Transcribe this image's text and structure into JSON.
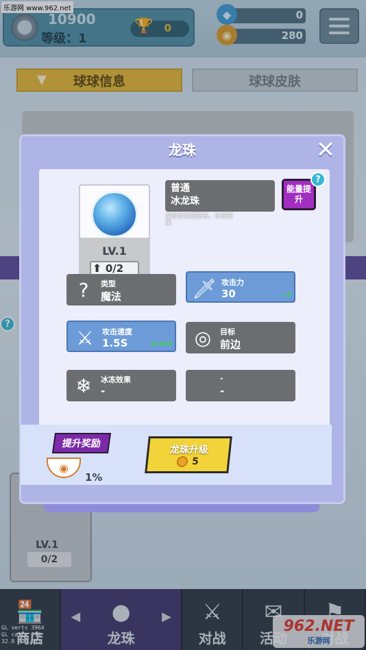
{
  "watermark_top": "乐游网 www.962.net",
  "player": {
    "score": "10900",
    "level_label": "等级：1",
    "trophies": "0"
  },
  "resources": {
    "gems": "0",
    "coins": "280"
  },
  "tabs": {
    "info": "球球信息",
    "skin": "球球皮肤"
  },
  "bg_card": {
    "level": "LV.1",
    "progress": "0/2"
  },
  "modal": {
    "title": "龙珠",
    "ball_level": "LV.1",
    "ball_progress": "0/2",
    "name_line1": "普通",
    "name_line2": "冰龙珠",
    "description": "使目标减速受冻，冰冻效果",
    "energy_button": "能量提升",
    "help": "?",
    "stats": [
      {
        "label": "类型",
        "value": "魔法",
        "bonus": "",
        "icon": "question-icon",
        "style": "gray"
      },
      {
        "label": "攻击力",
        "value": "30",
        "bonus": "+3",
        "icon": "sword-icon",
        "style": "blue"
      },
      {
        "label": "攻击速度",
        "value": "1.5S",
        "bonus": "-0.02S",
        "icon": "wing-sword-icon",
        "style": "blue"
      },
      {
        "label": "目标",
        "value": "前边",
        "bonus": "",
        "icon": "target-icon",
        "style": "gray"
      },
      {
        "label": "冰冻效果",
        "value": "-",
        "bonus": "",
        "icon": "ice-crystal-icon",
        "style": "gray"
      },
      {
        "label": "-",
        "value": "-",
        "bonus": "",
        "icon": "",
        "style": "gray"
      }
    ],
    "reward_tag": "提升奖励",
    "reward_percent": "1%",
    "upgrade_label": "龙珠升级",
    "upgrade_cost": "5"
  },
  "bottom_nav": [
    {
      "label": "商店",
      "icon": "shop-icon"
    },
    {
      "label": "龙珠",
      "icon": "dragon-ball-icon"
    },
    {
      "label": "对战",
      "icon": "swords-icon"
    },
    {
      "label": "活动",
      "icon": "event-icon"
    },
    {
      "label": "对战",
      "icon": "versus-icon"
    }
  ],
  "debug": "GL verts 3964\nGL calls 294\n32.8 / 0.031",
  "watermark_bottom": {
    "big": "962.NET",
    "small": "乐游网"
  }
}
